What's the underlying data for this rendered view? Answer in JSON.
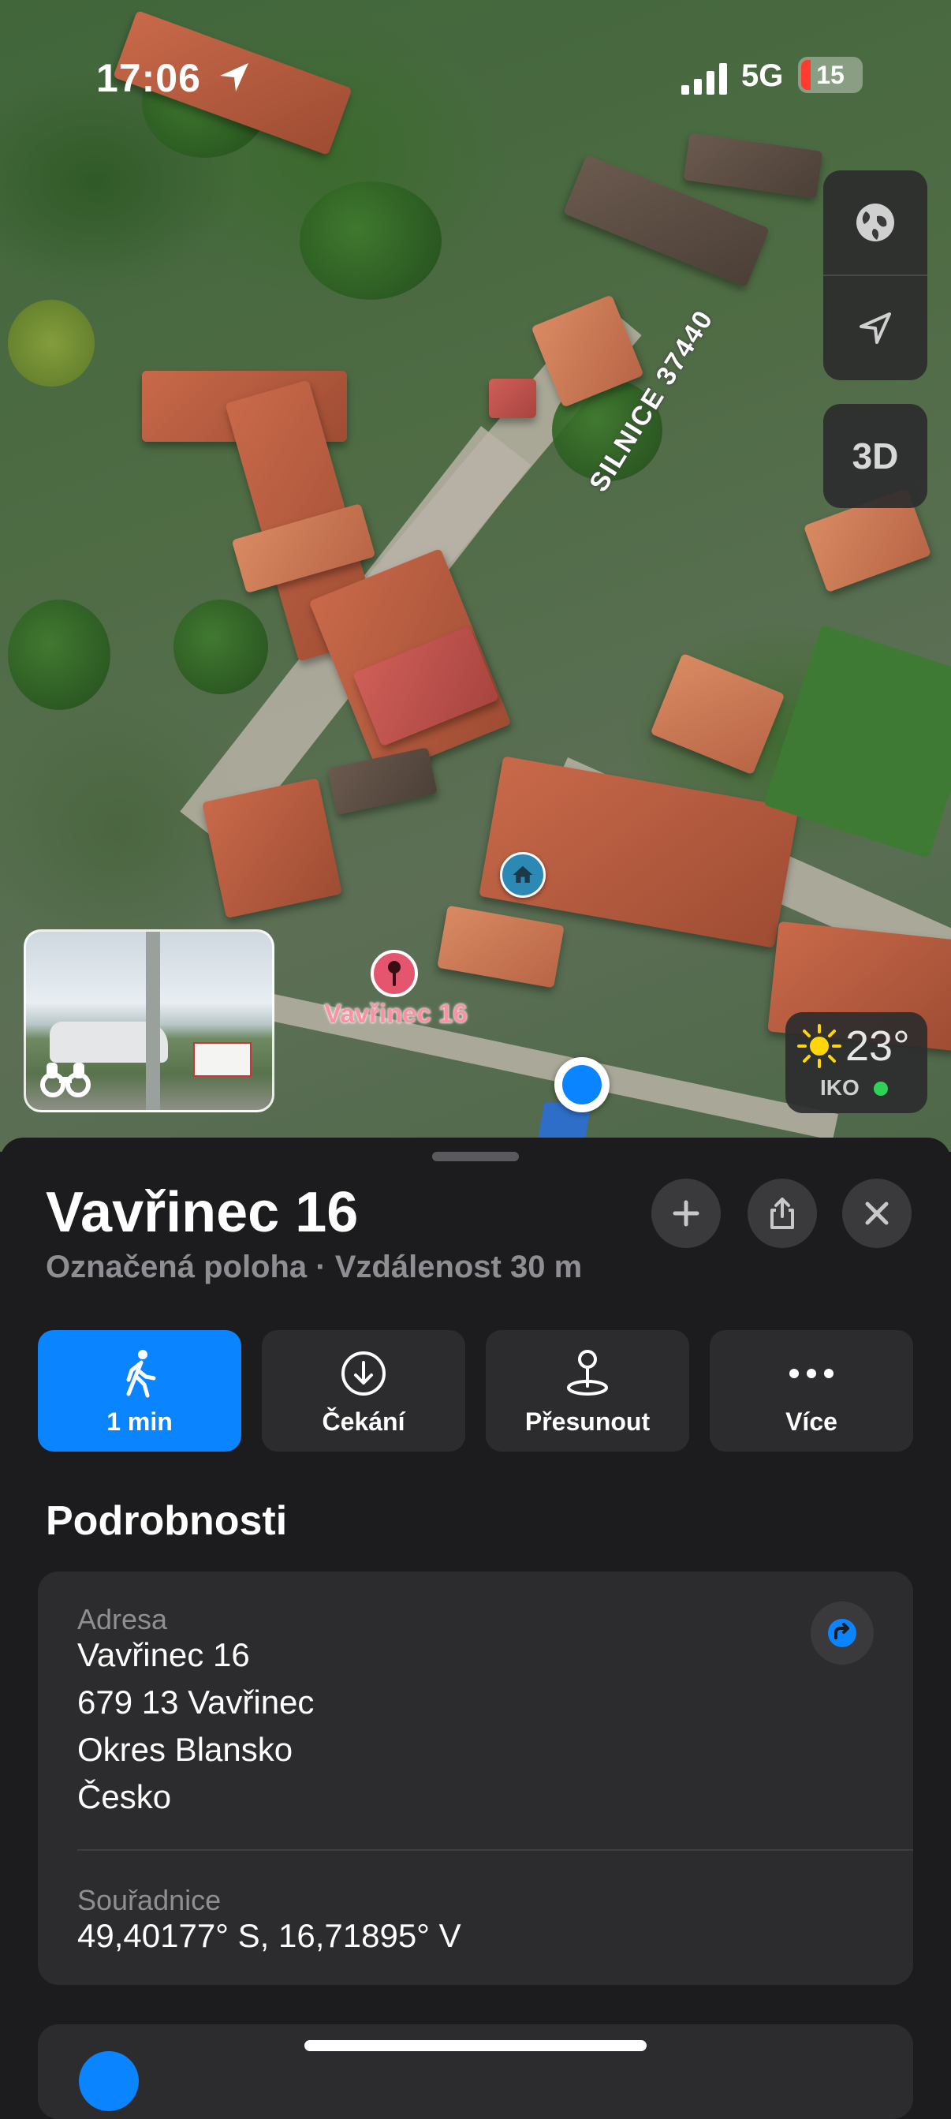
{
  "status_bar": {
    "time": "17:06",
    "network": "5G",
    "battery": "15"
  },
  "map": {
    "road_label": "SILNICE 37440",
    "marker_label": "Vavřinec 16",
    "map_controls": {
      "three_d_label": "3D"
    },
    "weather": {
      "temperature": "23°",
      "air_quality_label": "IKO",
      "air_quality_color": "#30d158"
    }
  },
  "place_card": {
    "title": "Vavřinec 16",
    "subtitle": "Označená poloha · Vzdálenost 30 m",
    "actions": [
      {
        "label": "1 min",
        "icon": "walking-icon"
      },
      {
        "label": "Čekání",
        "icon": "download-icon"
      },
      {
        "label": "Přesunout",
        "icon": "move-pin-icon"
      },
      {
        "label": "Více",
        "icon": "more-icon"
      }
    ],
    "details_title": "Podrobnosti",
    "address": {
      "label": "Adresa",
      "line1": "Vavřinec 16",
      "line2": "679 13 Vavřinec",
      "line3": "Okres Blansko",
      "line4": "Česko"
    },
    "coordinates": {
      "label": "Souřadnice",
      "value": "49,40177° S, 16,71895° V"
    }
  },
  "colors": {
    "accent": "#0a84ff",
    "sheet_background": "#1c1c1e",
    "card_background": "#2c2c2e",
    "marker_label": "#ff8fa3"
  }
}
